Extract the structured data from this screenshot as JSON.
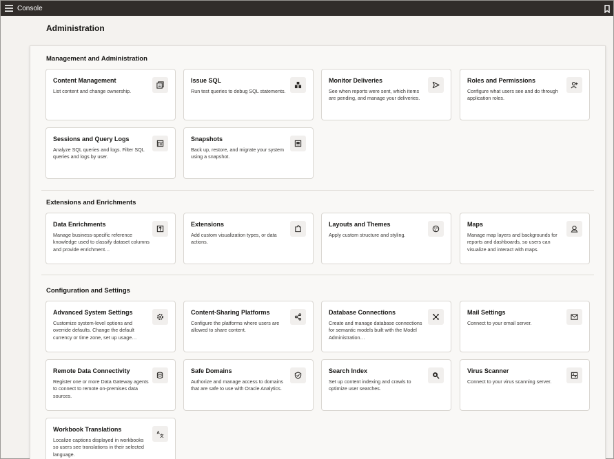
{
  "app": {
    "title": "Console",
    "page_title": "Administration"
  },
  "colors": {
    "topbar": "#312d2a",
    "background": "#f4f2ef",
    "card": "#ffffff"
  },
  "sections": [
    {
      "title": "Management and Administration",
      "cards": [
        {
          "title": "Content Management",
          "desc": "List content and change ownership.",
          "icon": "content-management-icon"
        },
        {
          "title": "Issue SQL",
          "desc": "Run test queries to debug SQL statements.",
          "icon": "issue-sql-icon"
        },
        {
          "title": "Monitor Deliveries",
          "desc": "See when reports were sent, which items are pending, and manage your deliveries.",
          "icon": "send-icon"
        },
        {
          "title": "Roles and Permissions",
          "desc": "Configure what users see and do through application roles.",
          "icon": "user-roles-icon"
        },
        {
          "title": "Sessions and Query Logs",
          "desc": "Analyze SQL queries and logs. Filter SQL queries and logs by user.",
          "icon": "logs-icon"
        },
        {
          "title": "Snapshots",
          "desc": "Back up, restore, and migrate your system using a snapshot.",
          "icon": "snapshot-icon"
        }
      ]
    },
    {
      "title": "Extensions and Enrichments",
      "cards": [
        {
          "title": "Data Enrichments",
          "desc": "Manage business-specific reference knowledge used to classify dataset columns and provide enrichment…",
          "icon": "data-enrichment-icon"
        },
        {
          "title": "Extensions",
          "desc": "Add custom visualization types, or data actions.",
          "icon": "extension-icon"
        },
        {
          "title": "Layouts and Themes",
          "desc": "Apply custom structure and styling.",
          "icon": "palette-icon"
        },
        {
          "title": "Maps",
          "desc": "Manage map layers and backgrounds for reports and dashboards, so users can visualize and interact with maps.",
          "icon": "map-pin-icon"
        }
      ]
    },
    {
      "title": "Configuration and Settings",
      "cards": [
        {
          "title": "Advanced System Settings",
          "desc": "Customize system-level options and override defaults. Change the default currency or time zone, set up usage…",
          "icon": "gear-icon"
        },
        {
          "title": "Content-Sharing Platforms",
          "desc": "Configure the platforms where users are allowed to share content.",
          "icon": "share-icon"
        },
        {
          "title": "Database Connections",
          "desc": "Create and manage database connections for semantic models built with the Model Administration…",
          "icon": "database-connection-icon"
        },
        {
          "title": "Mail Settings",
          "desc": "Connect to your email server.",
          "icon": "mail-icon"
        },
        {
          "title": "Remote Data Connectivity",
          "desc": "Register one or more Data Gateway agents to connect to remote on-premises data sources.",
          "icon": "database-icon"
        },
        {
          "title": "Safe Domains",
          "desc": "Authorize and manage access to domains that are safe to use with Oracle Analytics.",
          "icon": "shield-icon"
        },
        {
          "title": "Search Index",
          "desc": "Set up content indexing and crawls to optimize user searches.",
          "icon": "search-index-icon"
        },
        {
          "title": "Virus Scanner",
          "desc": "Connect to your virus scanning server.",
          "icon": "virus-scanner-icon"
        },
        {
          "title": "Workbook Translations",
          "desc": "Localize captions displayed in workbooks so users see translations in their selected language.",
          "icon": "translate-icon"
        }
      ]
    }
  ]
}
